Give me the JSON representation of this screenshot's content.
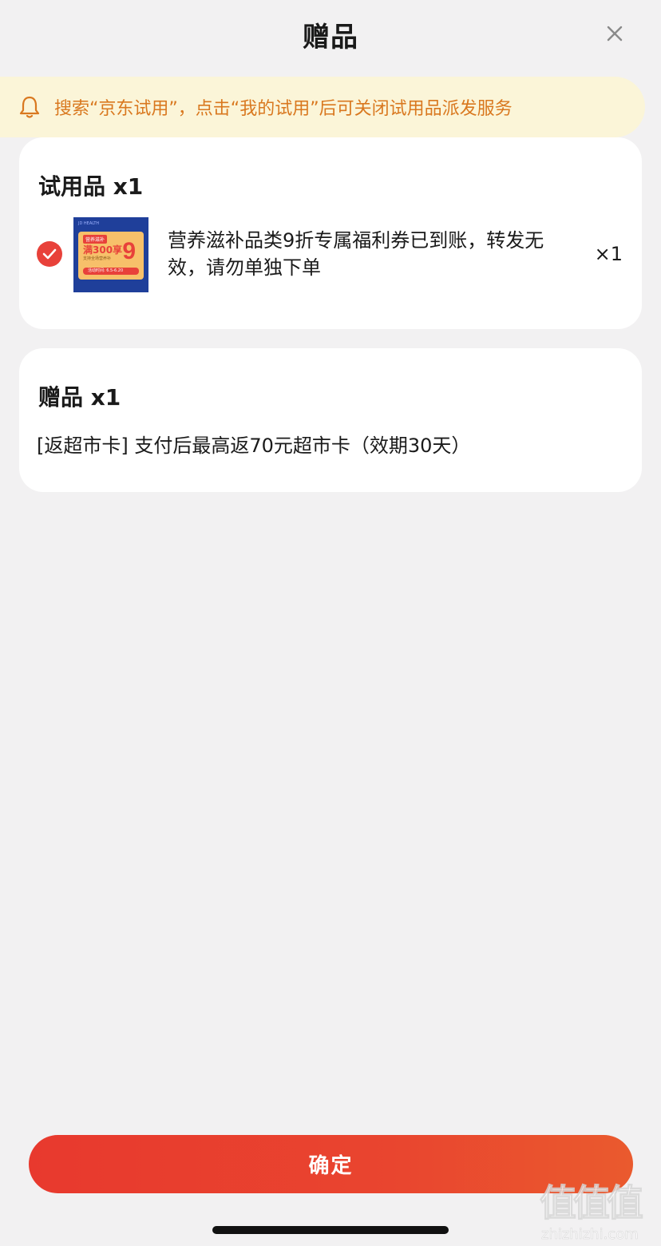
{
  "header": {
    "title": "赠品",
    "close_icon": "close-icon"
  },
  "notice": {
    "icon": "bell-icon",
    "text": "搜索“京东试用”，点击“我的试用”后可关闭试用品派发服务",
    "color": "#d9781f",
    "background": "#fbf5d8"
  },
  "trial_section": {
    "title": "试用品 x1",
    "item": {
      "checked": true,
      "image": {
        "tag": "营养滋补",
        "amount": "满300享",
        "discount_digit": "9",
        "subtitle": "支持全场营养补",
        "date": "活动时间: 6.5-6.20",
        "topline": "JD HEALTH"
      },
      "description": "营养滋补品类9折专属福利券已到账，转发无效，请勿单独下单",
      "quantity": "×1"
    }
  },
  "gift_section": {
    "title": "赠品 x1",
    "description": "[返超市卡] 支付后最高返70元超市卡（效期30天）"
  },
  "confirm_button": {
    "label": "确定",
    "color": "#e8392e"
  },
  "watermark": {
    "mark": "值值值",
    "url": "zhizhizhi.com"
  }
}
